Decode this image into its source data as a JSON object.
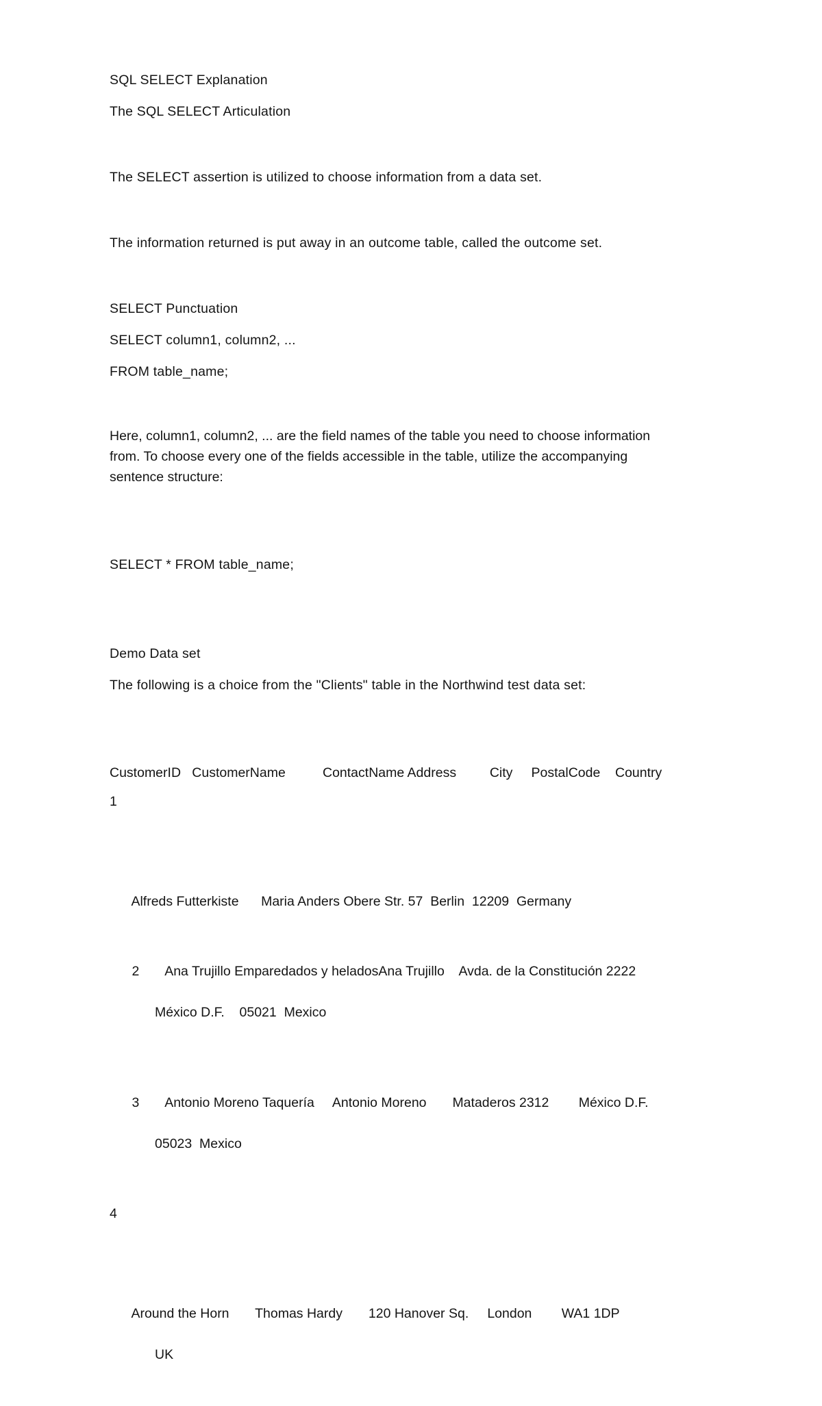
{
  "document": {
    "title": "SQL SELECT Explanation",
    "subtitle": "The SQL SELECT Articulation",
    "paragraphs": {
      "intro_1": "The SELECT assertion is utilized to choose information from a data set.",
      "intro_2": "The information returned is put away in an outcome table, called the outcome set.",
      "syntax_heading": "SELECT Punctuation",
      "syntax_line_1": "SELECT column1, column2, ...",
      "syntax_line_2": "FROM table_name;",
      "explain_line_1": "Here, column1, column2, ... are the field names of the table you need to choose information",
      "explain_line_2": "from. To choose every one of the fields accessible in the table, utilize the accompanying",
      "explain_line_3": "sentence structure:",
      "select_all": "SELECT * FROM table_name;",
      "demo_heading": "Demo Data set",
      "demo_intro": "The following is a choice from the \"Clients\" table in the Northwind test data set:"
    },
    "table": {
      "headers": [
        "CustomerID",
        "CustomerName",
        "ContactName",
        "Address",
        "City",
        "PostalCode",
        "Country"
      ],
      "header_line": "CustomerID   CustomerName          ContactName Address         City     PostalCode    Country",
      "rows": [
        {
          "id": "1",
          "id_line": "1",
          "body_line": "Alfreds Futterkiste      Maria Anders Obere Str. 57  Berlin  12209  Germany",
          "continuation": "",
          "CustomerID": "1",
          "CustomerName": "Alfreds Futterkiste",
          "ContactName": "Maria Anders",
          "Address": "Obere Str. 57",
          "City": "Berlin",
          "PostalCode": "12209",
          "Country": "Germany"
        },
        {
          "id": "2",
          "id_line": "",
          "body_line": "2       Ana Trujillo Emparedados y heladosAna Trujillo    Avda. de la Constitución 2222",
          "continuation": "México D.F.    05021  Mexico",
          "CustomerID": "2",
          "CustomerName": "Ana Trujillo Emparedados y helados",
          "ContactName": "Ana Trujillo",
          "Address": "Avda. de la Constitución 2222",
          "City": "México D.F.",
          "PostalCode": "05021",
          "Country": "Mexico"
        },
        {
          "id": "3",
          "id_line": "",
          "body_line": "3       Antonio Moreno Taquería     Antonio Moreno       Mataderos 2312        México D.F.",
          "continuation": "05023  Mexico",
          "CustomerID": "3",
          "CustomerName": "Antonio Moreno Taquería",
          "ContactName": "Antonio Moreno",
          "Address": "Mataderos 2312",
          "City": "México D.F.",
          "PostalCode": "05023",
          "Country": "Mexico"
        },
        {
          "id": "4",
          "id_line": "4",
          "body_line": "Around the Horn       Thomas Hardy       120 Hanover Sq.     London        WA1 1DP",
          "continuation": "UK",
          "CustomerID": "4",
          "CustomerName": "Around the Horn",
          "ContactName": "Thomas Hardy",
          "Address": "120 Hanover Sq.",
          "City": "London",
          "PostalCode": "WA1 1DP",
          "Country": "UK"
        }
      ]
    }
  }
}
